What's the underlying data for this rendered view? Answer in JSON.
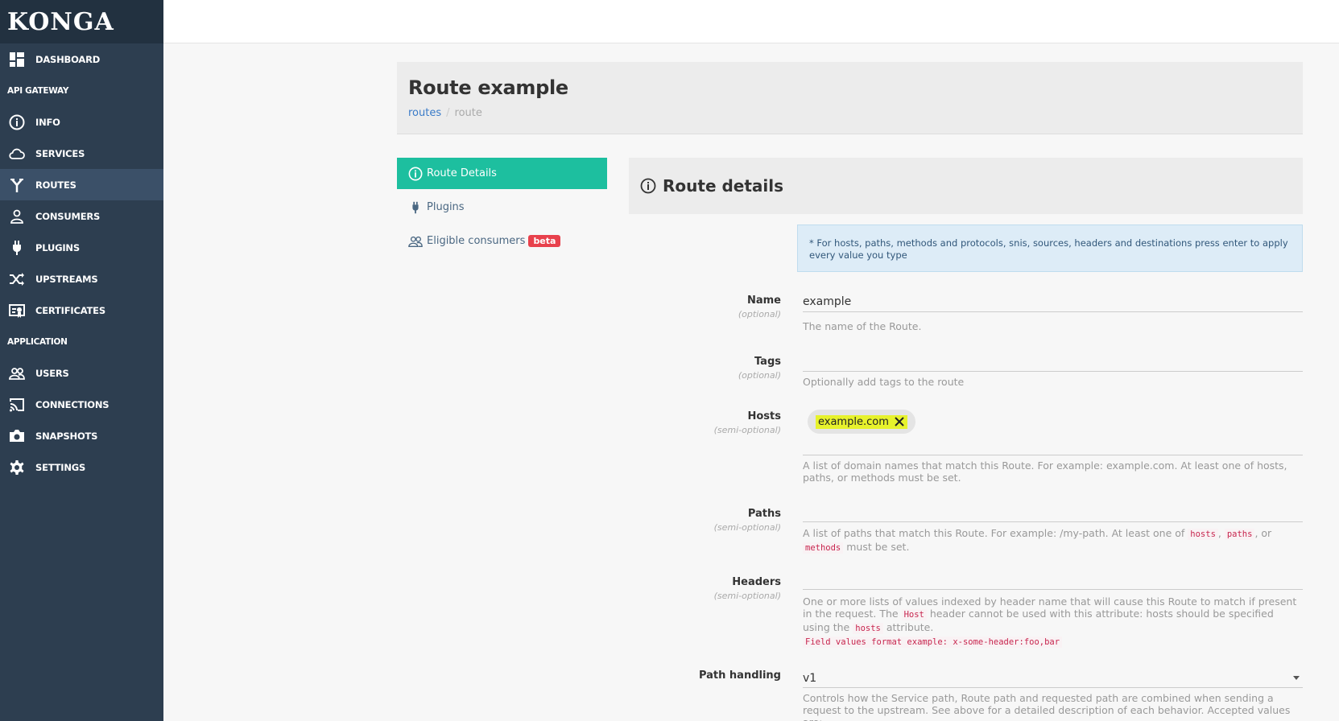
{
  "sidebar": {
    "logo": "KONGA",
    "dashboard": "DASHBOARD",
    "section_api": "API GATEWAY",
    "items_api": [
      {
        "label": "INFO",
        "icon": "info-icon"
      },
      {
        "label": "SERVICES",
        "icon": "cloud-icon"
      },
      {
        "label": "ROUTES",
        "icon": "routes-icon"
      },
      {
        "label": "CONSUMERS",
        "icon": "user-icon"
      },
      {
        "label": "PLUGINS",
        "icon": "plug-icon"
      },
      {
        "label": "UPSTREAMS",
        "icon": "shuffle-icon"
      },
      {
        "label": "CERTIFICATES",
        "icon": "certificate-icon"
      }
    ],
    "section_app": "APPLICATION",
    "items_app": [
      {
        "label": "USERS",
        "icon": "users-icon"
      },
      {
        "label": "CONNECTIONS",
        "icon": "cast-icon"
      },
      {
        "label": "SNAPSHOTS",
        "icon": "camera-icon"
      },
      {
        "label": "SETTINGS",
        "icon": "gear-icon"
      }
    ],
    "active": "ROUTES"
  },
  "header": {
    "title": "Route example",
    "breadcrumb": [
      "routes",
      "route"
    ]
  },
  "tabs": {
    "route_details": "Route Details",
    "plugins": "Plugins",
    "eligible_consumers": "Eligible consumers",
    "beta": "beta"
  },
  "panel": {
    "title": "Route details",
    "info": "* For hosts, paths, methods and protocols, snis, sources, headers and destinations press enter to apply every value you type"
  },
  "fields": {
    "name": {
      "label": "Name",
      "sub": "(optional)",
      "value": "example",
      "help": "The name of the Route."
    },
    "tags": {
      "label": "Tags",
      "sub": "(optional)",
      "value": "",
      "help": "Optionally add tags to the route"
    },
    "hosts": {
      "label": "Hosts",
      "sub": "(semi-optional)",
      "chip": "example.com",
      "help": "A list of domain names that match this Route. For example: example.com. At least one of hosts, paths, or methods must be set."
    },
    "paths": {
      "label": "Paths",
      "sub": "(semi-optional)",
      "help_pre": "A list of paths that match this Route. For example: /my-path. At least one of",
      "code1": "hosts",
      "code2": "paths",
      "help_or": ", or",
      "code3": "methods",
      "help_post": "must be set."
    },
    "headers": {
      "label": "Headers",
      "sub": "(semi-optional)",
      "help_a": "One or more lists of values indexed by header name that will cause this Route to match if present in the request. The",
      "code_host": "Host",
      "help_b": "header cannot be used with this attribute: hosts should be specified using the",
      "code_hosts": "hosts",
      "help_c": "attribute.",
      "code_format": "Field values format example: x-some-header:foo,bar"
    },
    "path_handling": {
      "label": "Path handling",
      "value": "v1",
      "help": "Controls how the Service path, Route path and requested path are combined when sending a request to the upstream. See above for a detailed description of each behavior. Accepted values are:"
    }
  }
}
